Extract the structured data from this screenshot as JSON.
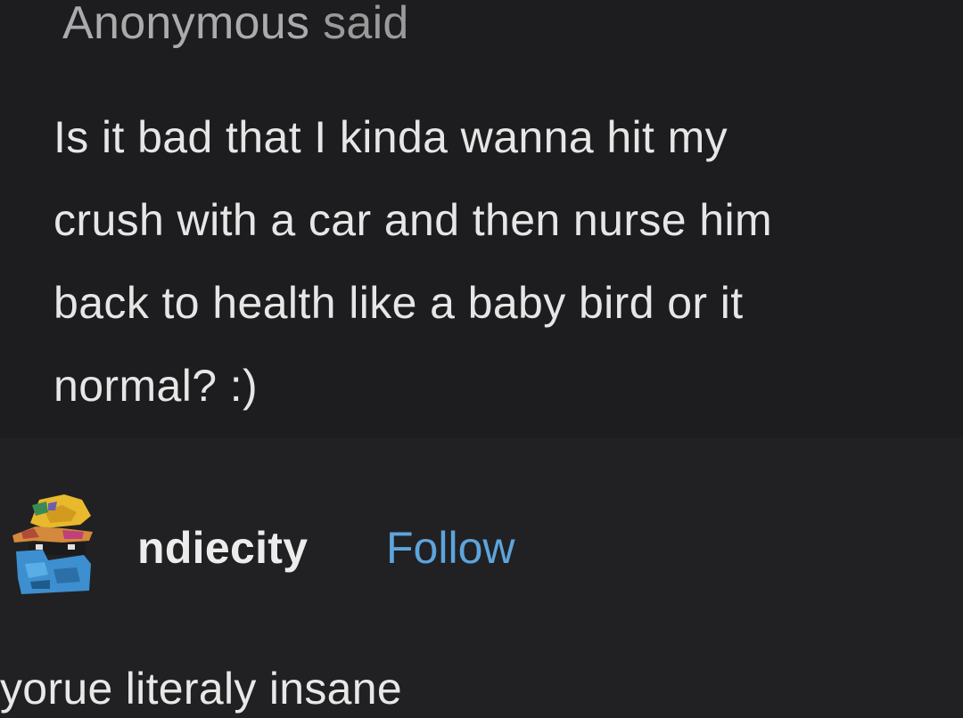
{
  "ask": {
    "asker_name": "Anonymous",
    "asker_suffix": "said",
    "question": "Is it bad that I kinda wanna hit my\ncrush with a car and then nurse him\nback to health like a baby bird or it\nnormal? :)"
  },
  "answer": {
    "avatar_icon": "pixel-art-avatar-icon",
    "username": "ndiecity",
    "follow_label": "Follow",
    "reply_text": "yorue literaly insane"
  },
  "colors": {
    "follow": "#5ea4dc",
    "background": "#202023"
  }
}
